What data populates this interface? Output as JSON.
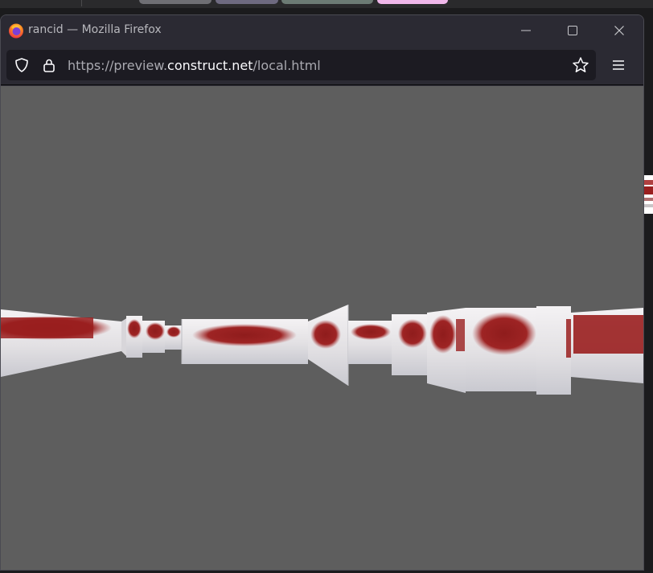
{
  "window": {
    "title": "rancid — Mozilla Firefox",
    "controls": {
      "minimize": "minimize-icon",
      "maximize": "maximize-icon",
      "close": "close-icon"
    }
  },
  "navbar": {
    "url_prefix": "https://preview.",
    "url_host": "construct.net",
    "url_path": "/local.html",
    "icons": [
      "shield-icon",
      "lock-icon",
      "bookmark-star-icon",
      "hamburger-menu-icon"
    ]
  },
  "content": {
    "background_color": "#5e5e5e",
    "object_color_main": "#9a1f1f",
    "object_color_surface": "#e8e6e8"
  }
}
